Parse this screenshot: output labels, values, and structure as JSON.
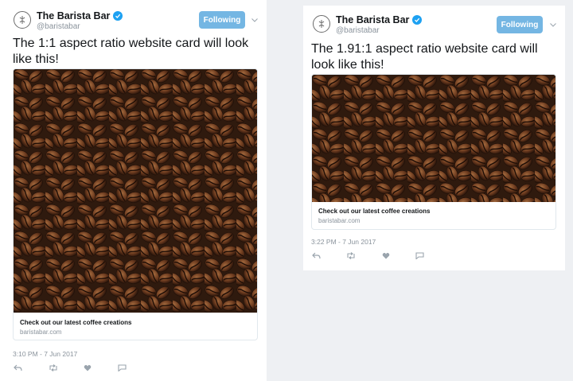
{
  "tweets": [
    {
      "display_name": "The Barista Bar",
      "handle": "@baristabar",
      "follow_label": "Following",
      "text": "The 1:1 aspect ratio website card will look like this!",
      "card": {
        "title": "Check out our latest coffee creations",
        "domain": "baristabar.com"
      },
      "timestamp": "3:10 PM - 7 Jun 2017"
    },
    {
      "display_name": "The Barista Bar",
      "handle": "@baristabar",
      "follow_label": "Following",
      "text": "The 1.91:1 aspect ratio website card will look like this!",
      "card": {
        "title": "Check out our latest coffee creations",
        "domain": "baristabar.com"
      },
      "timestamp": "3:22 PM - 7 Jun 2017"
    }
  ],
  "colors": {
    "accent": "#1da1f2",
    "follow_button": "#74b6e3",
    "muted_text": "#8a939c"
  },
  "icons": [
    "avatar-logo-icon",
    "verified-badge-icon",
    "chevron-down-icon",
    "reply-icon",
    "retweet-icon",
    "like-icon",
    "dm-icon"
  ]
}
